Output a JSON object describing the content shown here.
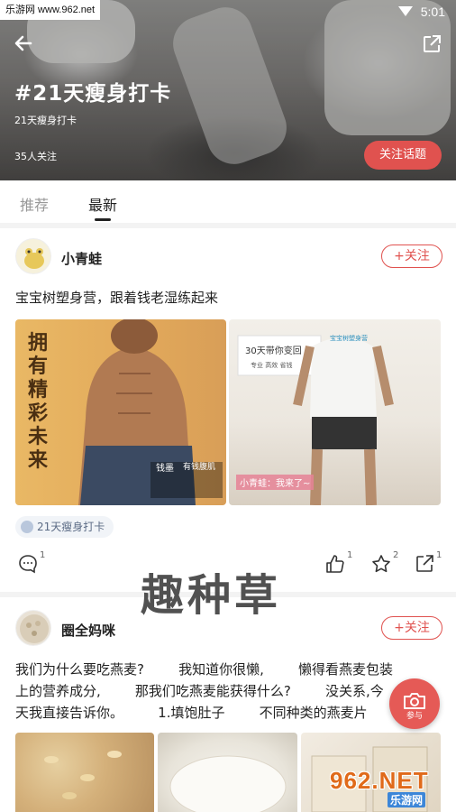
{
  "watermark_top": "乐游网 www.962.net",
  "status_bar": {
    "time": "5:01"
  },
  "topic": {
    "title": "#21天瘦身打卡",
    "subtitle": "21天瘦身打卡",
    "followers": "35人关注",
    "follow_label": "关注话题"
  },
  "tabs": [
    {
      "label": "推荐"
    },
    {
      "label": "最新"
    }
  ],
  "active_tab": "最新",
  "posts": [
    {
      "username": "小青蛙",
      "follow_label": "+关注",
      "text": "宝宝树塑身营，跟着钱老湿练起来",
      "images": [
        {
          "caption_lines": [
            "拥有精彩未来",
            "钱墨",
            "有钱腹肌"
          ]
        },
        {
          "caption_lines": [
            "30天带你变回",
            "宝宝树塑身营",
            "专业 高效 省钱",
            "小青蛙：我来了~"
          ]
        }
      ],
      "tag": "21天瘦身打卡",
      "actions": {
        "comments": "1",
        "likes": "1",
        "favorites": "2",
        "shares": "1"
      }
    },
    {
      "username": "圈全妈咪",
      "follow_label": "+关注",
      "text_lines": [
        "我们为什么要吃燕麦?        我知道你很懒,        懒得看燕麦包装",
        "上的营养成分,        那我们吃燕麦能获得什么?        没关系,今",
        "天我直接告诉你。        1.填饱肚子        不同种类的燕麦片"
      ]
    }
  ],
  "overlay_brand": "趣种草",
  "camera_label": "参与",
  "watermark_bottom": {
    "big": "962.NET",
    "small": "乐游网"
  },
  "colors": {
    "accent": "#e0524f",
    "tab_active": "#222222",
    "tab_inactive": "#999999"
  }
}
